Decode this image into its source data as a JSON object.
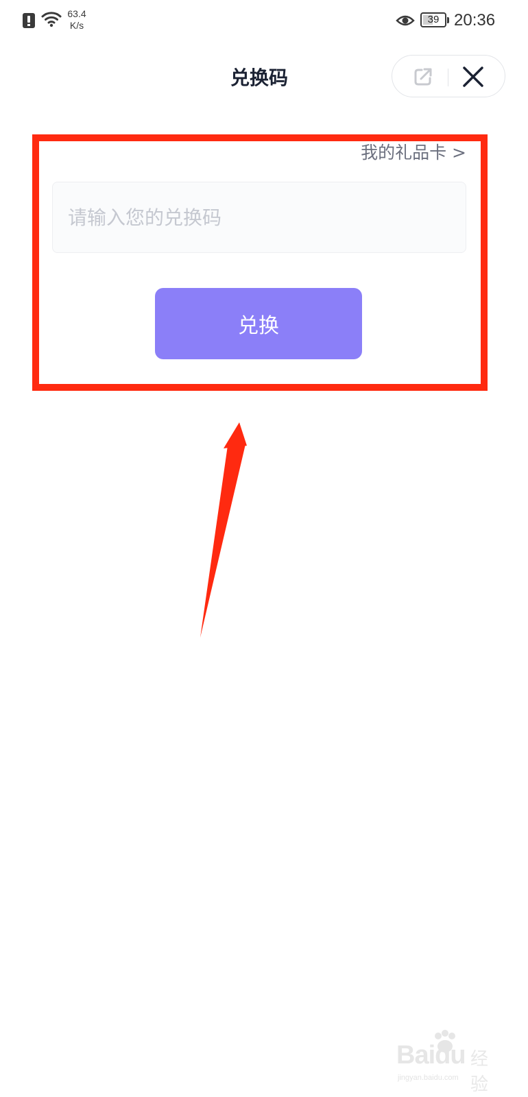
{
  "status_bar": {
    "network_speed_value": "63.4",
    "network_speed_unit": "K/s",
    "battery_level": "39",
    "time": "20:36",
    "icons": [
      "alert-icon",
      "wifi-icon",
      "eye-icon",
      "battery-icon"
    ]
  },
  "header": {
    "title": "兑换码",
    "share_icon": "share-icon",
    "close_icon": "close-icon"
  },
  "redeem_form": {
    "gift_card_link": "我的礼品卡 >",
    "code_input_placeholder": "请输入您的兑换码",
    "code_input_value": "",
    "redeem_button_label": "兑换"
  },
  "annotation": {
    "color": "#ff2a10"
  },
  "colors": {
    "accent_button": "#8b7ff8",
    "title_text": "#1b2233",
    "link_text": "#6b6f7e",
    "placeholder_text": "#c5c8d0"
  },
  "watermark": {
    "brand": "Baidu",
    "brand_cn": "经验",
    "url": "jingyan.baidu.com"
  }
}
